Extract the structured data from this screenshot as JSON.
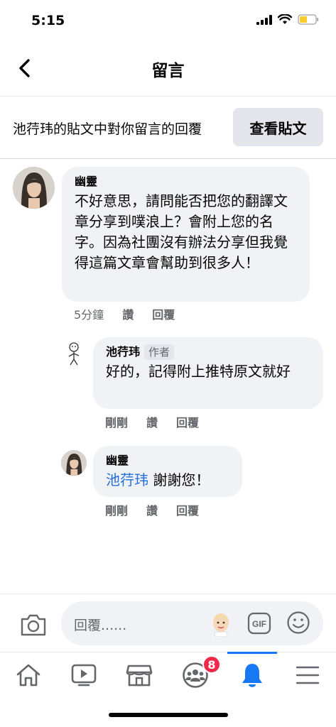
{
  "status_bar": {
    "time": "5:15"
  },
  "header": {
    "title": "留言"
  },
  "context": {
    "text": "池荇玮的貼文中對你留言的回覆",
    "view_post_label": "查看貼文"
  },
  "comments": [
    {
      "name": "幽靈",
      "text": "不好意思，請問能否把您的翻譯文章分享到噗浪上？會附上您的名字。因為社團沒有辦法分享但我覺得這篇文章會幫助到很多人！",
      "time": "5分鐘",
      "like": "讚",
      "reply": "回覆"
    },
    {
      "name": "池荇玮",
      "badge": "作者",
      "text": "好的，記得附上推特原文就好",
      "time": "剛剛",
      "like": "讚",
      "reply": "回覆"
    },
    {
      "name": "幽靈",
      "mention": "池荇玮",
      "text": " 謝謝您！",
      "time": "剛剛",
      "like": "讚",
      "reply": "回覆"
    }
  ],
  "reply_box": {
    "placeholder": "回覆......",
    "gif_label": "GIF"
  },
  "tab_bar": {
    "items": [
      "home",
      "watch",
      "marketplace",
      "groups",
      "notifications",
      "menu"
    ],
    "active": "notifications",
    "groups_badge": "8"
  },
  "colors": {
    "accent": "#1877f2",
    "badge": "#f02849",
    "bubble": "#f0f2f5",
    "mention": "#216fdb"
  }
}
